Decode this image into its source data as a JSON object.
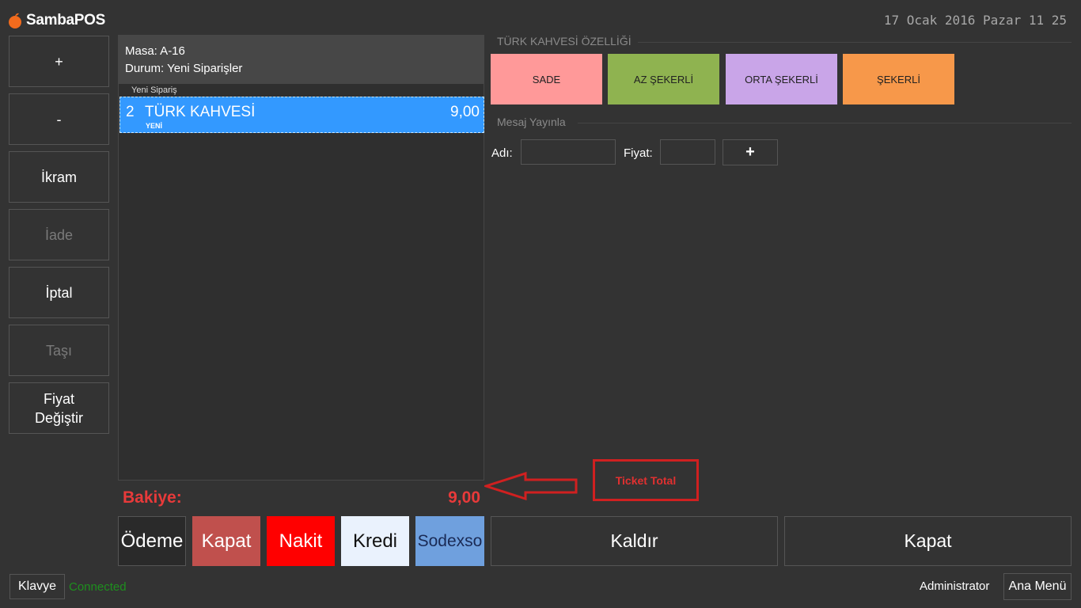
{
  "app": {
    "name": "SambaPOS",
    "datetime": "17 Ocak 2016 Pazar 11 25"
  },
  "side_buttons": [
    {
      "label": "+",
      "enabled": true
    },
    {
      "label": "-",
      "enabled": true
    },
    {
      "label": "İkram",
      "enabled": true
    },
    {
      "label": "İade",
      "enabled": false
    },
    {
      "label": "İptal",
      "enabled": true
    },
    {
      "label": "Taşı",
      "enabled": false
    },
    {
      "label": "Fiyat\nDeğiştir",
      "enabled": true
    }
  ],
  "ticket": {
    "table": "Masa: A-16",
    "status": "Durum: Yeni Siparişler",
    "group_label": "Yeni Sipariş",
    "orders": [
      {
        "qty": "2",
        "name": "TÜRK KAHVESİ",
        "price": "9,00",
        "state": "YENİ"
      }
    ]
  },
  "balance": {
    "label": "Bakiye:",
    "value": "9,00"
  },
  "payment_buttons": [
    {
      "label": "Ödeme",
      "color": "#2a2a2a"
    },
    {
      "label": "Kapat",
      "color": "#c0504d"
    },
    {
      "label": "Nakit",
      "color": "#ff0000"
    },
    {
      "label": "Kredi",
      "color": "#eaf2fd"
    },
    {
      "label": "Sodexso",
      "color": "#6fa0de"
    }
  ],
  "action_buttons": {
    "remove": "Kaldır",
    "close": "Kapat"
  },
  "properties": {
    "title": "TÜRK KAHVESİ ÖZELLİĞİ",
    "options": [
      {
        "label": "SADE",
        "color": "#ff9999"
      },
      {
        "label": "AZ ŞEKERLİ",
        "color": "#8fb350"
      },
      {
        "label": "ORTA ŞEKERLİ",
        "color": "#c9a5e8"
      },
      {
        "label": "ŞEKERLİ",
        "color": "#f7984a"
      }
    ]
  },
  "message": {
    "title": "Mesaj Yayınla",
    "name_label": "Adı:",
    "price_label": "Fiyat:",
    "name_value": "",
    "price_value": "",
    "add_label": "+"
  },
  "annotation": {
    "text": "Ticket Total",
    "color": "#d02020"
  },
  "footer": {
    "keyboard": "Klavye",
    "status": "Connected",
    "user": "Administrator",
    "main_menu": "Ana Menü"
  }
}
